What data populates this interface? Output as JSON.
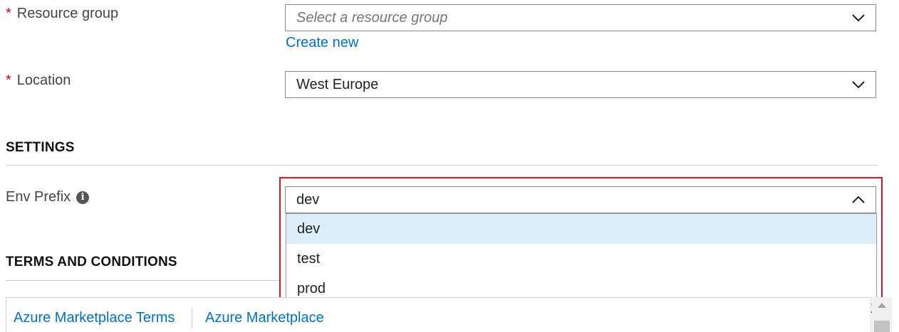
{
  "resource_group": {
    "required_mark": "*",
    "label": "Resource group",
    "placeholder": "Select a resource group",
    "create_new_link": "Create new",
    "icon": "chevron-down-icon"
  },
  "location": {
    "required_mark": "*",
    "label": "Location",
    "value": "West Europe",
    "icon": "chevron-down-icon"
  },
  "settings": {
    "title": "SETTINGS",
    "env_prefix": {
      "label": "Env Prefix",
      "info_icon": "info-icon",
      "value": "dev",
      "expanded": true,
      "icon": "chevron-up-icon",
      "options": [
        "dev",
        "test",
        "prod"
      ],
      "selected_option": "dev"
    }
  },
  "terms": {
    "title": "TERMS AND CONDITIONS",
    "links": [
      "Azure Marketplace Terms",
      "Azure Marketplace"
    ]
  },
  "colors": {
    "highlight_border": "#e0141e",
    "link": "#0072c6",
    "required": "#d0021b",
    "selected_option_bg": "#ddeefb"
  }
}
